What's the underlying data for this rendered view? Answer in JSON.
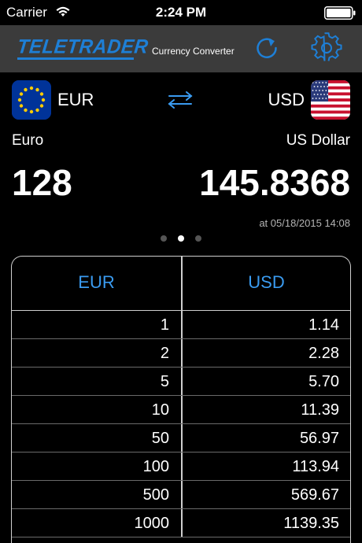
{
  "status_bar": {
    "carrier": "Carrier",
    "time": "2:24 PM"
  },
  "nav": {
    "logo_text": "TELETRADER",
    "title": "Currency Converter",
    "refresh_icon": "refresh-icon",
    "settings_icon": "gear-icon",
    "accent_color": "#1e7fd6"
  },
  "converter": {
    "from_code": "EUR",
    "to_code": "USD",
    "from_name": "Euro",
    "to_name": "US Dollar",
    "from_amount": "128",
    "to_amount": "145.8368",
    "timestamp": "at 05/18/2015 14:08",
    "page_count": 3,
    "active_page": 1
  },
  "table": {
    "headers": [
      "EUR",
      "USD"
    ],
    "rows": [
      [
        "1",
        "1.14"
      ],
      [
        "2",
        "2.28"
      ],
      [
        "5",
        "5.70"
      ],
      [
        "10",
        "11.39"
      ],
      [
        "50",
        "56.97"
      ],
      [
        "100",
        "113.94"
      ],
      [
        "500",
        "569.67"
      ],
      [
        "1000",
        "1139.35"
      ]
    ]
  }
}
